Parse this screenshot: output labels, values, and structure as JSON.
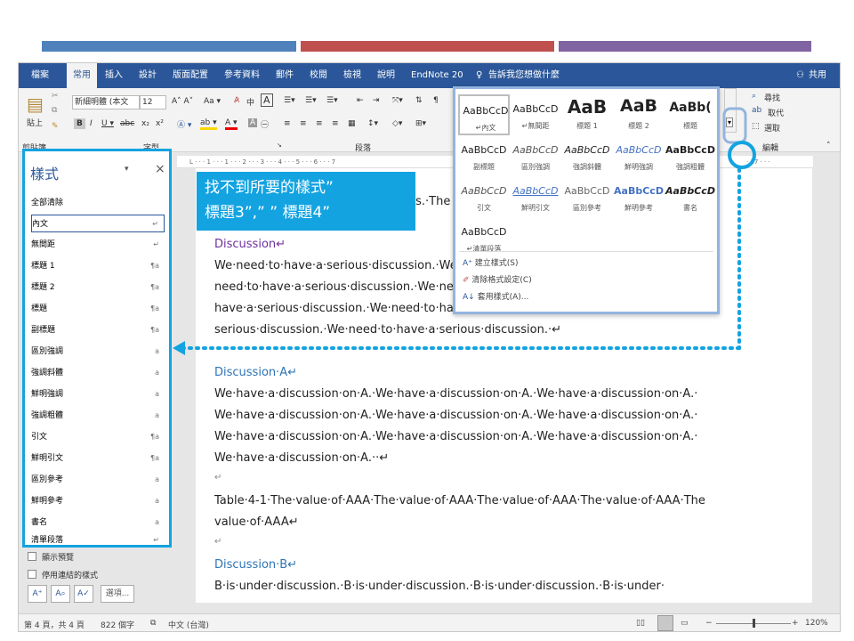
{
  "colors": {
    "bar1": "#4f81bd",
    "bar2": "#c0504d",
    "bar3": "#8064a2",
    "ribbon": "#2b579a",
    "accent": "#13a3e1",
    "heading": "#2e74b5",
    "heading_purple": "#7030a0"
  },
  "ribbon_tabs": [
    "檔案",
    "常用",
    "插入",
    "設計",
    "版面配置",
    "參考資料",
    "郵件",
    "校閱",
    "檢視",
    "說明",
    "EndNote 20"
  ],
  "tell_me": "告訴我您想做什麼",
  "share": "共用",
  "ribbon": {
    "paste": "貼上",
    "clipboard": "剪貼簿",
    "font": "字型",
    "paragraph": "段落",
    "editing": "編輯",
    "font_name": "新細明體 (本文",
    "font_size": "12",
    "find": "尋找",
    "replace": "取代",
    "select": "選取"
  },
  "pane": {
    "title": "樣式",
    "items": [
      {
        "label": "全部清除",
        "mark": ""
      },
      {
        "label": "內文",
        "mark": "↵"
      },
      {
        "label": "無間距",
        "mark": "↵"
      },
      {
        "label": "標題 1",
        "mark": "¶a"
      },
      {
        "label": "標題 2",
        "mark": "¶a"
      },
      {
        "label": "標題",
        "mark": "¶a"
      },
      {
        "label": "副標題",
        "mark": "¶a"
      },
      {
        "label": "區別強調",
        "mark": "a"
      },
      {
        "label": "強調斜體",
        "mark": "a"
      },
      {
        "label": "鮮明強調",
        "mark": "a"
      },
      {
        "label": "強調粗體",
        "mark": "a"
      },
      {
        "label": "引文",
        "mark": "¶a"
      },
      {
        "label": "鮮明引文",
        "mark": "¶a"
      },
      {
        "label": "區別參考",
        "mark": "a"
      },
      {
        "label": "鮮明參考",
        "mark": "a"
      },
      {
        "label": "書名",
        "mark": "a"
      },
      {
        "label": "清單段落",
        "mark": "↵"
      }
    ],
    "show_preview": "顯示預覽",
    "disable_linked": "停用連結的樣式",
    "options": "選項..."
  },
  "callout": {
    "line1": "找不到所要的樣式”",
    "line2": "標題3”,”  ” 標題4”"
  },
  "gallery": {
    "items": [
      {
        "sample": "AaBbCcD",
        "name": "↵內文"
      },
      {
        "sample": "AaBbCcD",
        "name": "↵無間距"
      },
      {
        "sample": "AaB",
        "name": "標題 1"
      },
      {
        "sample": "AaB",
        "name": "標題 2"
      },
      {
        "sample": "AaBb(",
        "name": "標題"
      },
      {
        "sample": "AaBbCcD",
        "name": "副標題"
      },
      {
        "sample": "AaBbCcD",
        "name": "區別強調"
      },
      {
        "sample": "AaBbCcD",
        "name": "強調斜體"
      },
      {
        "sample": "AaBbCcD",
        "name": "鮮明強調"
      },
      {
        "sample": "AaBbCcD",
        "name": "強調粗體"
      },
      {
        "sample": "AaBbCcD",
        "name": "引文"
      },
      {
        "sample": "AaBbCcD",
        "name": "鮮明引文"
      },
      {
        "sample": "AaBbCcD",
        "name": "區別參考"
      },
      {
        "sample": "AaBbCcD",
        "name": "鮮明參考"
      },
      {
        "sample": "AaBbCcD",
        "name": "書名"
      },
      {
        "sample": "AaBbCcD",
        "name": "↵清單段落"
      }
    ],
    "menu": [
      "建立樣式(S)",
      "清除格式設定(C)",
      "套用樣式(A)..."
    ]
  },
  "doc": {
    "frag": "ts.·The",
    "h1": "Discussion↵",
    "p1": [
      "We·need·to·have·a·serious·discussion.·We",
      "need·to·have·a·serious·discussion.·We·ne",
      "have·a·serious·discussion.·We·need·to·have·a·serious·discussion.·We·need·to·have·a",
      "serious·discussion.·We·need·to·have·a·serious·discussion.·↵"
    ],
    "h2": "Discussion·A↵",
    "p2": [
      "We·have·a·discussion·on·A.·We·have·a·discussion·on·A.·We·have·a·discussion·on·A.·",
      "We·have·a·discussion·on·A.·We·have·a·discussion·on·A.·We·have·a·discussion·on·A.·",
      "We·have·a·discussion·on·A.·We·have·a·discussion·on·A.·We·have·a·discussion·on·A.·",
      "We·have·a·discussion·on·A.··↵"
    ],
    "empty": "↵",
    "table": [
      "Table·4-1·The·value·of·AAA·The·value·of·AAA·The·value·of·AAA·The·value·of·AAA·The",
      "value·of·AAA↵"
    ],
    "h3": "Discussion·B↵",
    "p3": "B·is·under·discussion.·B·is·under·discussion.·B·is·under·discussion.·B·is·under·"
  },
  "ruler": "L · · · 1 · · · 1 · · · 2 · · · 3 · · · 4 · · · 5 · · · 6 · · · 7",
  "ruler_right": "· 17 · · ·",
  "status": {
    "page": "第 4 頁，共 4 頁",
    "words": "822 個字",
    "lang": "中文 (台灣)",
    "zoom": "120%"
  }
}
